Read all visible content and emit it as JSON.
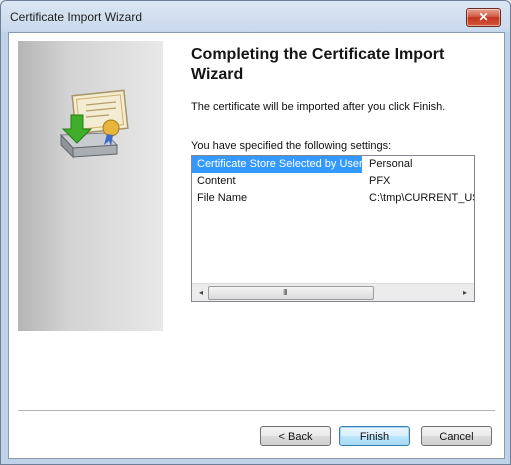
{
  "window": {
    "title": "Certificate Import Wizard",
    "close_icon": "close-icon"
  },
  "page": {
    "heading": "Completing the Certificate Import Wizard",
    "description": "The certificate will be imported after you click Finish.",
    "settings_label": "You have specified the following settings:"
  },
  "settings": [
    {
      "name": "Certificate Store Selected by User",
      "value": "Personal",
      "selected": true
    },
    {
      "name": "Content",
      "value": "PFX",
      "selected": false
    },
    {
      "name": "File Name",
      "value": "C:\\tmp\\CURRENT_US",
      "selected": false
    }
  ],
  "scrollbar": {
    "left_arrow": "◂",
    "right_arrow": "▸",
    "grip": "III"
  },
  "buttons": {
    "back": "< Back",
    "finish": "Finish",
    "cancel": "Cancel"
  },
  "colors": {
    "selection": "#3399ff",
    "close": "#c7452c"
  }
}
